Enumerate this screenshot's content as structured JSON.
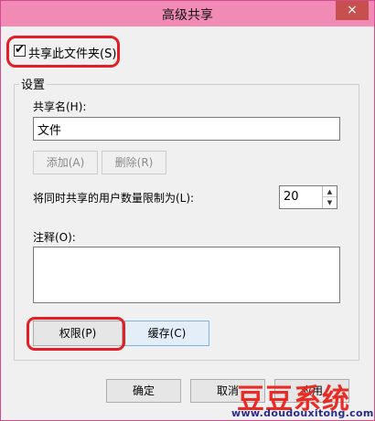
{
  "window": {
    "title": "高级共享",
    "close_glyph": "×"
  },
  "share": {
    "checked": true,
    "check_glyph": "✔",
    "label": "共享此文件夹(S)"
  },
  "settings": {
    "group_label": "设置",
    "share_name_label": "共享名(H):",
    "share_name_value": "文件",
    "add_button": "添加(A)",
    "remove_button": "删除(R)",
    "limit_label": "将同时共享的用户数量限制为(L):",
    "limit_value": "20",
    "spin_up_glyph": "▲",
    "spin_down_glyph": "▼",
    "comment_label": "注释(O):",
    "comment_value": "",
    "permissions_button": "权限(P)",
    "cache_button": "缓存(C)"
  },
  "footer": {
    "ok_button": "确定",
    "cancel_button": "取消",
    "apply_button": "应用"
  },
  "watermark": {
    "text": "豆豆系统",
    "url": "www.doudouxitong.com",
    "color": "#e92a25"
  },
  "colors": {
    "titlebar": "#f28ab6",
    "close_button": "#c7504f",
    "annotation": "#e41e26"
  }
}
